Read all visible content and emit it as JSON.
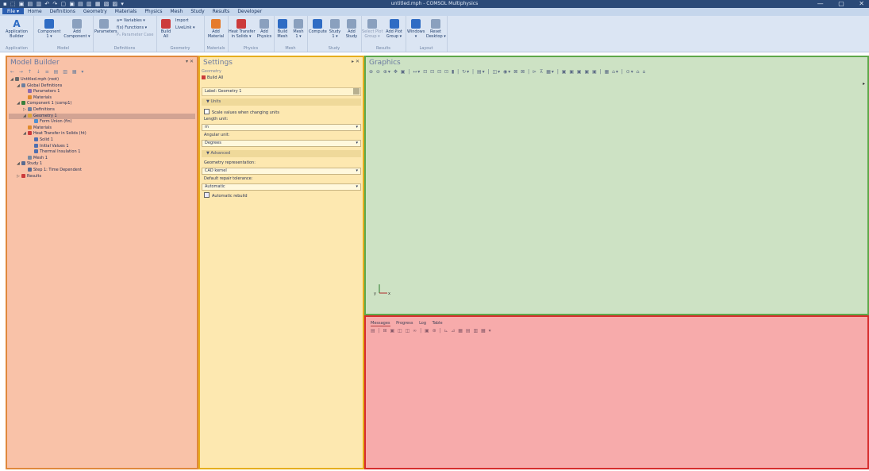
{
  "window": {
    "title": "untitled.mph - COMSOL Multiphysics",
    "quick_access": "▪ ⬚ ▣ ▤ ▥ ↶ ↷ ▢ ▣ ▤ ▥ ▦ ▧ ▨ ▾",
    "controls": [
      "—",
      "▢",
      "✕"
    ]
  },
  "menu": {
    "file": "File ▾",
    "items": [
      "Home",
      "Definitions",
      "Geometry",
      "Materials",
      "Physics",
      "Mesh",
      "Study",
      "Results",
      "Developer"
    ]
  },
  "ribbon": {
    "groups": [
      {
        "caption": "Application",
        "buttons": [
          {
            "label": "Application\nBuilder",
            "icon": "application-builder-icon"
          }
        ]
      },
      {
        "caption": "Model",
        "buttons": [
          {
            "label": "Component\n1 ▾",
            "icon": "component-icon"
          },
          {
            "label": "Add\nComponent ▾",
            "icon": "add-component-icon"
          }
        ]
      },
      {
        "caption": "Definitions",
        "buttons": [
          {
            "label": "Parameters",
            "icon": "parameters-icon"
          }
        ],
        "small": [
          "a= Variables ▾",
          "f(x) Functions ▾",
          "P₁ Parameter Case"
        ]
      },
      {
        "caption": "Geometry",
        "buttons": [
          {
            "label": "Build\nAll",
            "icon": "build-all-icon"
          }
        ],
        "small": [
          "Import",
          "LiveLink ▾"
        ]
      },
      {
        "caption": "Materials",
        "buttons": [
          {
            "label": "Add\nMaterial",
            "icon": "add-material-icon"
          }
        ]
      },
      {
        "caption": "Physics",
        "buttons": [
          {
            "label": "Heat Transfer\nin Solids ▾",
            "icon": "heat-transfer-icon"
          },
          {
            "label": "Add\nPhysics",
            "icon": "add-physics-icon"
          }
        ]
      },
      {
        "caption": "Mesh",
        "buttons": [
          {
            "label": "Build\nMesh",
            "icon": "build-mesh-icon"
          },
          {
            "label": "Mesh\n1 ▾",
            "icon": "mesh-icon"
          }
        ]
      },
      {
        "caption": "Study",
        "buttons": [
          {
            "label": "Compute",
            "icon": "compute-icon"
          },
          {
            "label": "Study\n1 ▾",
            "icon": "study-icon"
          },
          {
            "label": "Add\nStudy",
            "icon": "add-study-icon"
          }
        ]
      },
      {
        "caption": "Results",
        "buttons": [
          {
            "label": "Select Plot\nGroup ▾",
            "icon": "select-plot-icon"
          },
          {
            "label": "Add Plot\nGroup ▾",
            "icon": "add-plot-icon"
          }
        ]
      },
      {
        "caption": "Layout",
        "buttons": [
          {
            "label": "Windows\n▾",
            "icon": "windows-icon"
          },
          {
            "label": "Reset\nDesktop ▾",
            "icon": "reset-desktop-icon"
          }
        ]
      }
    ]
  },
  "model_builder": {
    "title": "Model Builder",
    "toolbar": "← → ↑ ↓ ≡ ▤ ▥ ▦ ▾",
    "tree": [
      {
        "label": "Untitled.mph (root)",
        "indent": 0,
        "twisty": "◢",
        "icon": "root-icon",
        "color": "#6b6b6b"
      },
      {
        "label": "Global Definitions",
        "indent": 1,
        "twisty": "◢",
        "icon": "global-definitions-icon",
        "color": "#6c7fa0"
      },
      {
        "label": "Parameters 1",
        "indent": 2,
        "twisty": "",
        "icon": "parameters-icon",
        "color": "#8c6bb0"
      },
      {
        "label": "Materials",
        "indent": 2,
        "twisty": "",
        "icon": "materials-icon",
        "color": "#e08a2c"
      },
      {
        "label": "Component 1 (comp1)",
        "indent": 1,
        "twisty": "◢",
        "icon": "component-icon",
        "color": "#3a7f3a"
      },
      {
        "label": "Definitions",
        "indent": 2,
        "twisty": "▷",
        "icon": "definitions-icon",
        "color": "#6c7fa0"
      },
      {
        "label": "Geometry 1",
        "indent": 2,
        "twisty": "◢",
        "icon": "geometry-icon",
        "color": "#d9a23a",
        "selected": true
      },
      {
        "label": "Form Union (fin)",
        "indent": 3,
        "twisty": "",
        "icon": "form-union-icon",
        "color": "#4f8fd0"
      },
      {
        "label": "Materials",
        "indent": 2,
        "twisty": "",
        "icon": "materials-icon",
        "color": "#e08a2c"
      },
      {
        "label": "Heat Transfer in Solids (ht)",
        "indent": 2,
        "twisty": "◢",
        "icon": "heat-transfer-icon",
        "color": "#cc3b3b"
      },
      {
        "label": "Solid 1",
        "indent": 3,
        "twisty": "",
        "icon": "solid-icon",
        "color": "#4f6fb0"
      },
      {
        "label": "Initial Values 1",
        "indent": 3,
        "twisty": "",
        "icon": "initial-values-icon",
        "color": "#4f6fb0"
      },
      {
        "label": "Thermal Insulation 1",
        "indent": 3,
        "twisty": "",
        "icon": "thermal-insulation-icon",
        "color": "#4f6fb0"
      },
      {
        "label": "Mesh 1",
        "indent": 2,
        "twisty": "",
        "icon": "mesh-icon",
        "color": "#7a8aa0"
      },
      {
        "label": "Study 1",
        "indent": 1,
        "twisty": "◢",
        "icon": "study-icon",
        "color": "#5a6a90"
      },
      {
        "label": "Step 1: Time Dependent",
        "indent": 2,
        "twisty": "",
        "icon": "step-icon",
        "color": "#5a6a90"
      },
      {
        "label": "Results",
        "indent": 1,
        "twisty": "▷",
        "icon": "results-icon",
        "color": "#cc3b3b"
      }
    ]
  },
  "settings": {
    "title": "Settings",
    "subtitle": "Geometry",
    "build_all": "Build All",
    "label_caption": "Label:",
    "label_value": "Geometry 1",
    "units_section": "Units",
    "scale_values": "Scale values when changing units",
    "length_unit_caption": "Length unit:",
    "length_unit_value": "m",
    "angular_unit_caption": "Angular unit:",
    "angular_unit_value": "Degrees",
    "advanced_section": "Advanced",
    "geometry_representation_caption": "Geometry representation:",
    "geometry_representation_value": "CAD kernel",
    "default_repair_caption": "Default repair tolerance:",
    "default_repair_value": "Automatic",
    "automatic_rebuild": "Automatic rebuild"
  },
  "graphics": {
    "title": "Graphics",
    "toolbar": "⊕ ⊖ ⊕▾ ✥ ▣ | ↔▾ ⊡ ⊡ ⊡ ⊡ ▮ | ↻▾ | ▤▾ | ◫▾ ◉▾ ⊠ ⊠ | ⊳ ⊼ ▦▾ | ▣ ▣ ▣ ▣ ▣ | ▦ ⌂▾ | ⊙▾ ⌂ ⌂",
    "axis_label": "y ↑ x →"
  },
  "messages": {
    "tabs": [
      "Messages",
      "Progress",
      "Log",
      "Table"
    ],
    "active_tab": "Messages",
    "toolbar": "▤ | ⊞ ▣ ◫ ◫ ∞ | ▣ ⊛ | ⊾ ⊿ ▦ ▤ ▥ ▦ ▾"
  }
}
